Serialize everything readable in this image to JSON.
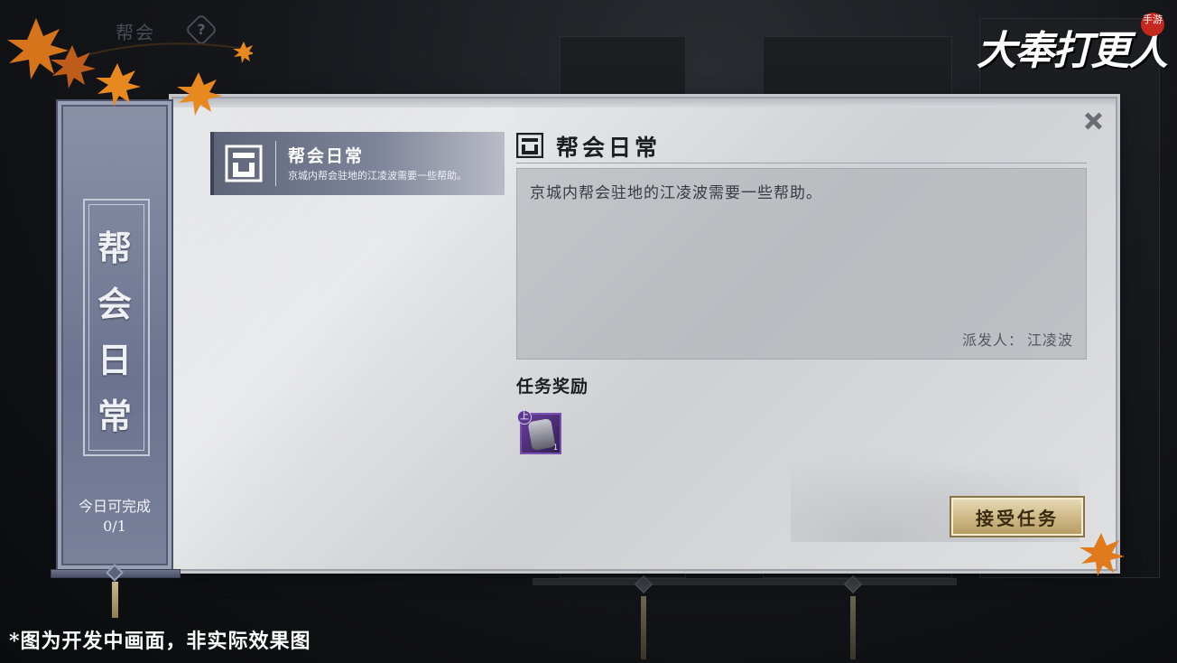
{
  "background": {
    "topleft_label": "帮会",
    "help_glyph": "?"
  },
  "logo": {
    "title": "大奉打更人",
    "seal": "手游"
  },
  "banner": {
    "title_chars": [
      "帮",
      "会",
      "日",
      "常"
    ],
    "daily_label": "今日可完成",
    "daily_progress": "0/1"
  },
  "quest_list": [
    {
      "title": "帮会日常",
      "description": "京城内帮会驻地的江凌波需要一些帮助。"
    }
  ],
  "detail": {
    "title": "帮会日常",
    "description": "京城内帮会驻地的江凌波需要一些帮助。",
    "sender_label": "派发人：",
    "sender_name": "江凌波",
    "reward_label": "任务奖励",
    "reward": {
      "grade_badge": "上",
      "count_text": "1"
    },
    "accept_button": "接受任务"
  },
  "disclaimer": "*图为开发中画面，非实际效果图",
  "colors": {
    "banner": "#6c7390",
    "button_gold": "#cdb784",
    "reward_purple": "#6a3f9e",
    "leaf_orange": "#e07a1c"
  }
}
